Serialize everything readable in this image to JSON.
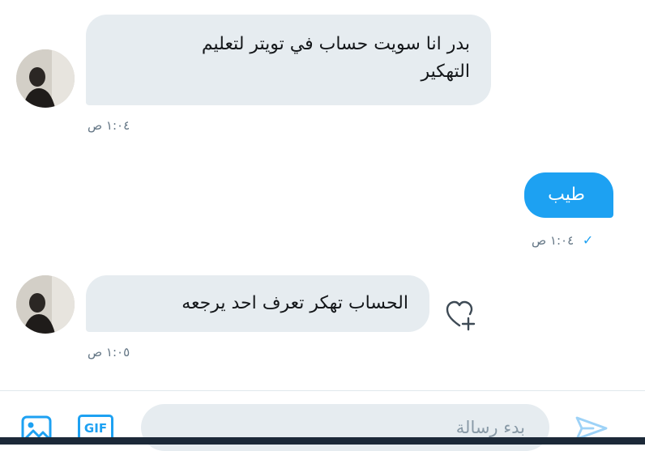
{
  "messages": [
    {
      "direction": "incoming",
      "text_line1": "بدر انا سويت حساب في تويتر لتعليم",
      "text_line2": "التهكير",
      "time": "١:٠٤ ص"
    },
    {
      "direction": "outgoing",
      "text": "طيب",
      "time": "١:٠٤ ص",
      "status": "✓"
    },
    {
      "direction": "incoming",
      "text": "الحساب تهكر تعرف احد يرجعه",
      "time": "١:٠٥ ص"
    }
  ],
  "composer": {
    "placeholder": "بدء رسالة",
    "icons": [
      "image-icon",
      "gif-icon",
      "send-icon"
    ],
    "gif_label": "GIF"
  },
  "colors": {
    "incoming_bubble": "#e6ecf0",
    "outgoing_bubble": "#1da1f2",
    "timestamp": "#657786",
    "accent": "#1da1f2"
  }
}
